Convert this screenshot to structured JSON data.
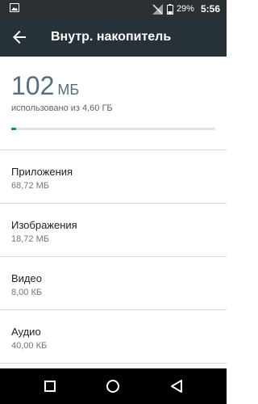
{
  "status_bar": {
    "battery": "29%",
    "time": "5:56",
    "icons": [
      "image-notification-icon",
      "no-signal-icon",
      "battery-icon"
    ]
  },
  "header": {
    "title": "Внутр. накопитель",
    "back_icon": "arrow-back-icon"
  },
  "storage": {
    "used_value": "102",
    "used_unit": "МБ",
    "caption": "использовано из 4,60 ГБ",
    "used_fraction": 0.022,
    "bar_color": "#0e8f7f"
  },
  "categories": [
    {
      "name": "Приложения",
      "size": "68,72 МБ"
    },
    {
      "name": "Изображения",
      "size": "18,72 МБ"
    },
    {
      "name": "Видео",
      "size": "8,00 КБ"
    },
    {
      "name": "Аудио",
      "size": "40,00 КБ"
    }
  ],
  "nav": {
    "icons": [
      "overview-square-icon",
      "home-circle-icon",
      "back-triangle-icon"
    ]
  },
  "colors": {
    "status_bar": "#2b3033",
    "app_bar": "#263238",
    "accent": "#0e8f7f"
  }
}
